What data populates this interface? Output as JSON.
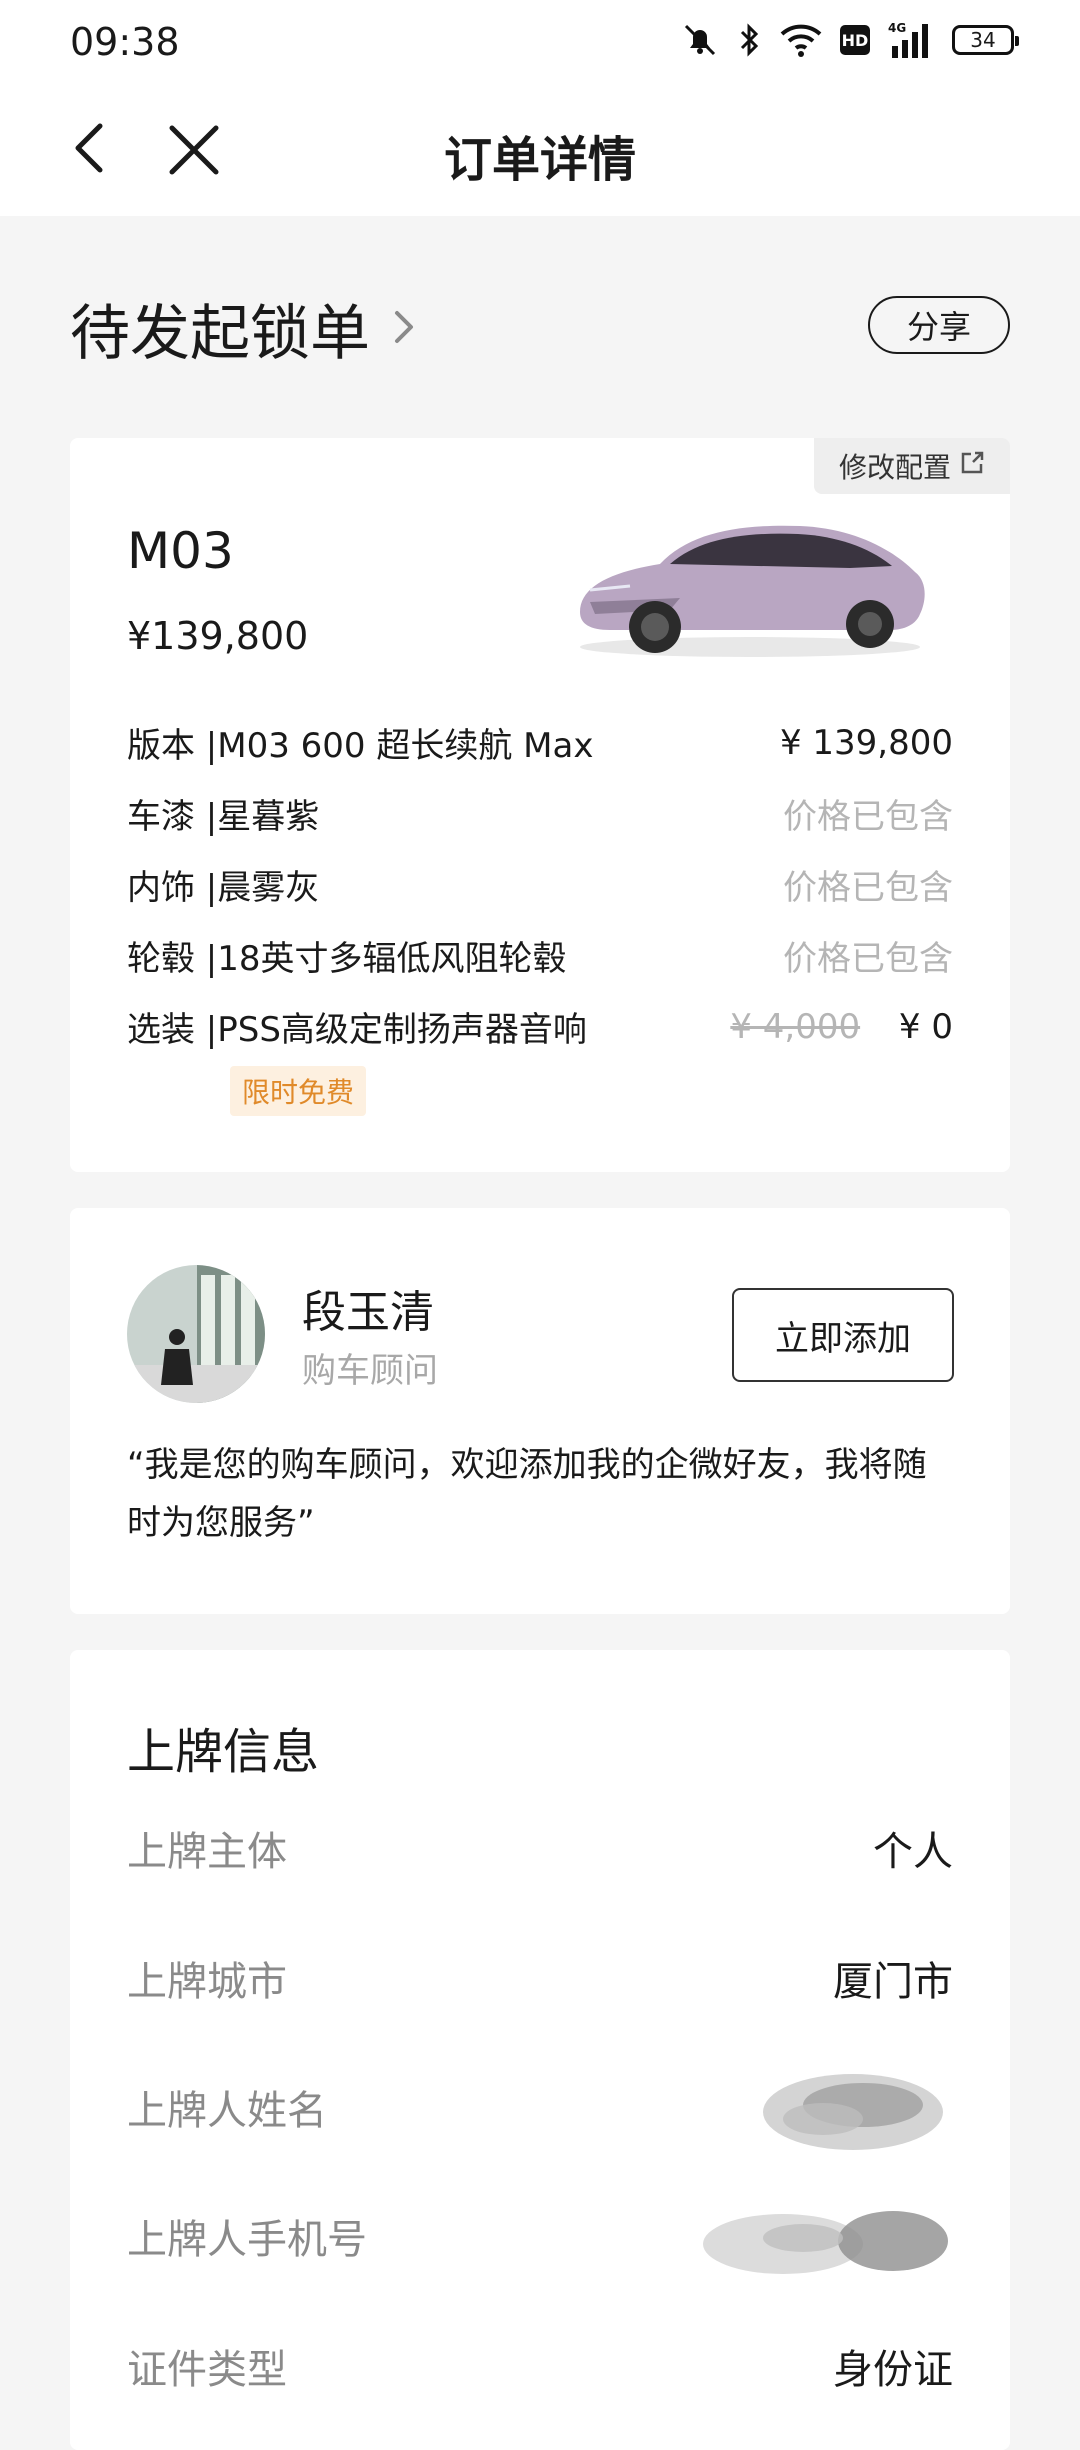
{
  "status_bar": {
    "time": "09:38",
    "hd": "HD",
    "signal_label": "4G",
    "battery": "34"
  },
  "nav": {
    "title": "订单详情"
  },
  "order": {
    "status": "待发起锁单",
    "share": "分享"
  },
  "car_card": {
    "modify": "修改配置",
    "model": "M03",
    "price": "¥139,800",
    "specs": [
      {
        "label": "版本 | ",
        "value": "M03 600 超长续航 Max",
        "price": "¥ 139,800"
      },
      {
        "label": "车漆 | ",
        "value": "星暮紫",
        "price": "价格已包含"
      },
      {
        "label": "内饰 | ",
        "value": "晨雾灰",
        "price": "价格已包含"
      },
      {
        "label": "轮毂 | ",
        "value": "18英寸多辐低风阻轮毂",
        "price": "价格已包含"
      },
      {
        "label": "选装 | ",
        "value": "PSS高级定制扬声器音响",
        "original_price": "¥ 4,000",
        "price": "¥ 0"
      }
    ],
    "promo_tag": "限时免费"
  },
  "advisor": {
    "name": "段玉清",
    "role": "购车顾问",
    "add_button": "立即添加",
    "quote": "“我是您的购车顾问，欢迎添加我的企微好友，我将随时为您服务”"
  },
  "plate_info": {
    "title": "上牌信息",
    "rows": [
      {
        "label": "上牌主体",
        "value": "个人"
      },
      {
        "label": "上牌城市",
        "value": "厦门市"
      },
      {
        "label": "上牌人姓名",
        "value": ""
      },
      {
        "label": "上牌人手机号",
        "value": ""
      },
      {
        "label": "证件类型",
        "value": "身份证"
      }
    ]
  },
  "colors": {
    "muted": "#b5b5b5",
    "promo_bg": "#fdf0e0",
    "promo_text": "#e08a2a",
    "card_bg": "#ffffff",
    "page_bg": "#f5f5f5"
  }
}
